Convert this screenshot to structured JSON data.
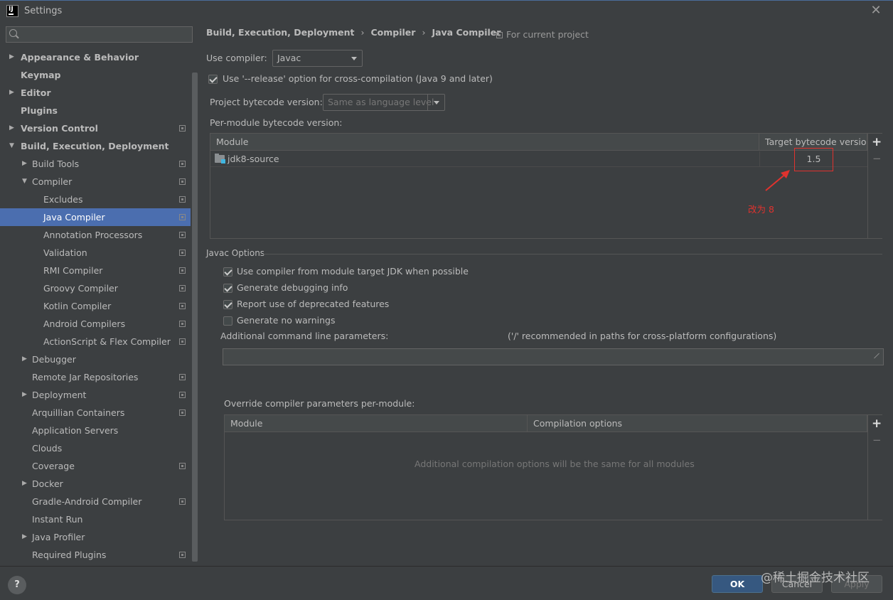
{
  "window": {
    "title": "Settings"
  },
  "search": {
    "placeholder": "",
    "value": ""
  },
  "sidebar": {
    "items": [
      {
        "label": "Appearance & Behavior",
        "level": 0,
        "arrow": "right",
        "bold": true,
        "project": false
      },
      {
        "label": "Keymap",
        "level": 0,
        "arrow": "",
        "bold": true,
        "project": false
      },
      {
        "label": "Editor",
        "level": 0,
        "arrow": "right",
        "bold": true,
        "project": false
      },
      {
        "label": "Plugins",
        "level": 0,
        "arrow": "",
        "bold": true,
        "project": false
      },
      {
        "label": "Version Control",
        "level": 0,
        "arrow": "right",
        "bold": true,
        "project": true
      },
      {
        "label": "Build, Execution, Deployment",
        "level": 0,
        "arrow": "down",
        "bold": true,
        "project": false
      },
      {
        "label": "Build Tools",
        "level": 1,
        "arrow": "right",
        "bold": false,
        "project": true
      },
      {
        "label": "Compiler",
        "level": 1,
        "arrow": "down",
        "bold": false,
        "project": true
      },
      {
        "label": "Excludes",
        "level": 2,
        "arrow": "",
        "bold": false,
        "project": true
      },
      {
        "label": "Java Compiler",
        "level": 2,
        "arrow": "",
        "bold": false,
        "project": true,
        "selected": true
      },
      {
        "label": "Annotation Processors",
        "level": 2,
        "arrow": "",
        "bold": false,
        "project": true
      },
      {
        "label": "Validation",
        "level": 2,
        "arrow": "",
        "bold": false,
        "project": true
      },
      {
        "label": "RMI Compiler",
        "level": 2,
        "arrow": "",
        "bold": false,
        "project": true
      },
      {
        "label": "Groovy Compiler",
        "level": 2,
        "arrow": "",
        "bold": false,
        "project": true
      },
      {
        "label": "Kotlin Compiler",
        "level": 2,
        "arrow": "",
        "bold": false,
        "project": true
      },
      {
        "label": "Android Compilers",
        "level": 2,
        "arrow": "",
        "bold": false,
        "project": true
      },
      {
        "label": "ActionScript & Flex Compiler",
        "level": 2,
        "arrow": "",
        "bold": false,
        "project": true
      },
      {
        "label": "Debugger",
        "level": 1,
        "arrow": "right",
        "bold": false,
        "project": false
      },
      {
        "label": "Remote Jar Repositories",
        "level": 1,
        "arrow": "",
        "bold": false,
        "project": true
      },
      {
        "label": "Deployment",
        "level": 1,
        "arrow": "right",
        "bold": false,
        "project": true
      },
      {
        "label": "Arquillian Containers",
        "level": 1,
        "arrow": "",
        "bold": false,
        "project": true
      },
      {
        "label": "Application Servers",
        "level": 1,
        "arrow": "",
        "bold": false,
        "project": false
      },
      {
        "label": "Clouds",
        "level": 1,
        "arrow": "",
        "bold": false,
        "project": false
      },
      {
        "label": "Coverage",
        "level": 1,
        "arrow": "",
        "bold": false,
        "project": true
      },
      {
        "label": "Docker",
        "level": 1,
        "arrow": "right",
        "bold": false,
        "project": false
      },
      {
        "label": "Gradle-Android Compiler",
        "level": 1,
        "arrow": "",
        "bold": false,
        "project": true
      },
      {
        "label": "Instant Run",
        "level": 1,
        "arrow": "",
        "bold": false,
        "project": false
      },
      {
        "label": "Java Profiler",
        "level": 1,
        "arrow": "right",
        "bold": false,
        "project": false
      },
      {
        "label": "Required Plugins",
        "level": 1,
        "arrow": "",
        "bold": false,
        "project": true
      }
    ]
  },
  "breadcrumb": [
    "Build, Execution, Deployment",
    "Compiler",
    "Java Compiler"
  ],
  "breadcrumb_separator": "›",
  "for_project": "For current project",
  "compiler": {
    "use_compiler_label": "Use compiler:",
    "use_compiler_value": "Javac",
    "release_option_label": "Use '--release' option for cross-compilation (Java 9 and later)",
    "release_option_checked": true,
    "project_bytecode_label": "Project bytecode version:",
    "project_bytecode_value": "Same as language level",
    "per_module_label": "Per-module bytecode version:"
  },
  "module_table": {
    "headers": [
      "Module",
      "Target bytecode version"
    ],
    "rows": [
      {
        "module": "jdk8-source",
        "version": "1.5"
      }
    ],
    "add": "+",
    "remove": "−"
  },
  "annotation": {
    "text": "改为 8",
    "color": "#e0322e"
  },
  "javac": {
    "group_title": "Javac Options",
    "options": [
      {
        "label": "Use compiler from module target JDK when possible",
        "checked": true
      },
      {
        "label": "Generate debugging info",
        "checked": true
      },
      {
        "label": "Report use of deprecated features",
        "checked": true
      },
      {
        "label": "Generate no warnings",
        "checked": false
      }
    ],
    "additional_params_label": "Additional command line parameters:",
    "additional_params_hint": "('/' recommended in paths for cross-platform configurations)",
    "additional_params_value": ""
  },
  "override": {
    "label": "Override compiler parameters per-module:",
    "headers": [
      "Module",
      "Compilation options"
    ],
    "empty_text": "Additional compilation options will be the same for all modules",
    "add": "+",
    "remove": "−"
  },
  "footer": {
    "help": "?",
    "ok": "OK",
    "cancel": "Cancel",
    "apply": "Apply"
  },
  "watermark": "@稀土掘金技术社区",
  "colors": {
    "selection": "#4b6eaf",
    "background": "#3c3f41",
    "primary_button": "#365880",
    "annotation": "#e0322e"
  }
}
